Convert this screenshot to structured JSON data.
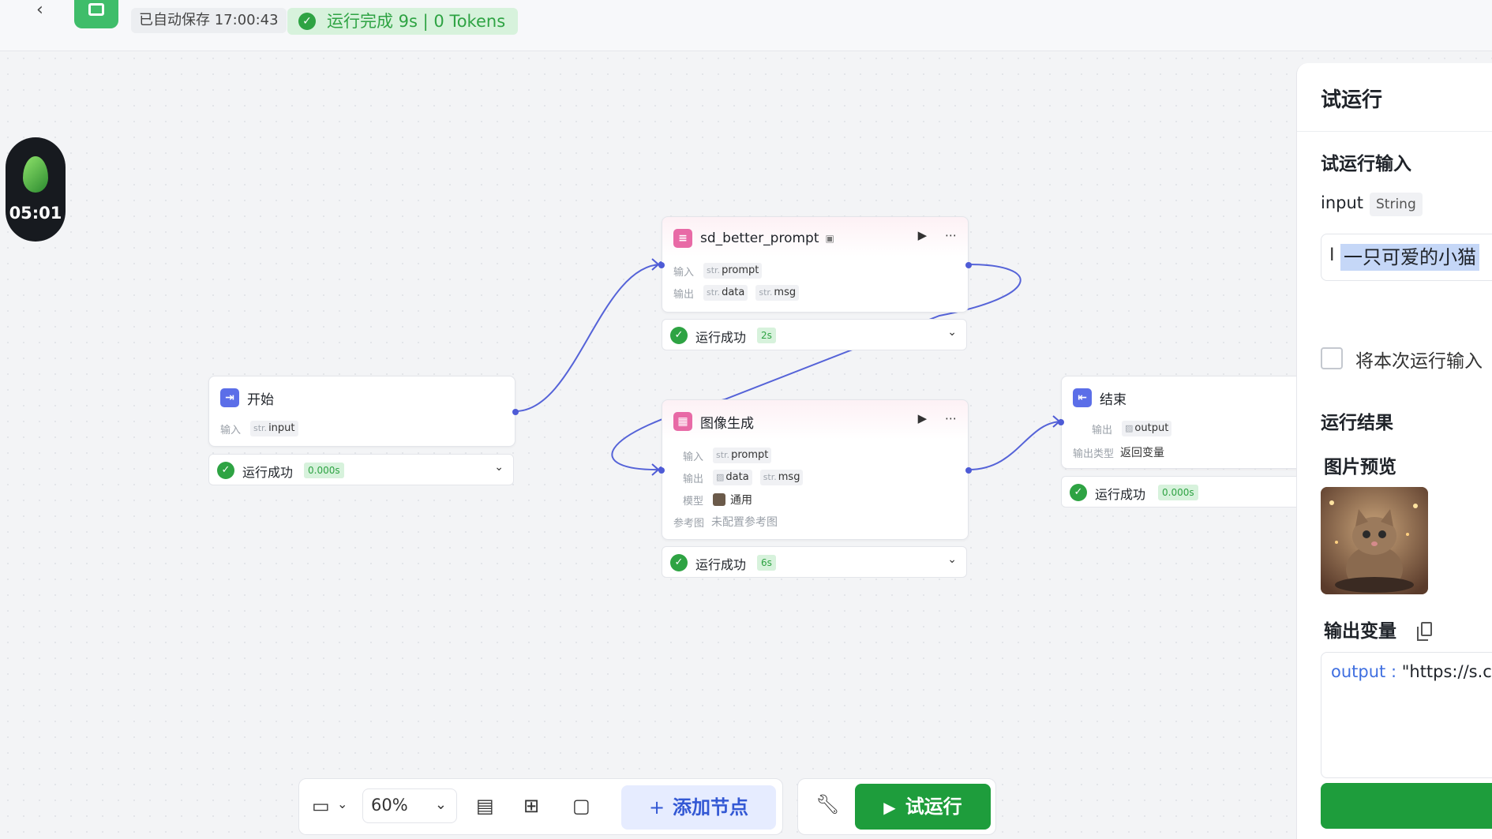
{
  "topbar": {
    "autosave": "已自动保存 17:00:43",
    "run_status": "运行完成 9s | 0 Tokens"
  },
  "timer": {
    "time": "05:01"
  },
  "nodes": {
    "start": {
      "title": "开始",
      "input_label": "输入",
      "input_type": "str.",
      "input_name": "input",
      "status": "运行成功",
      "duration": "0.000s"
    },
    "prompt": {
      "title": "sd_better_prompt",
      "input_label": "输入",
      "output_label": "输出",
      "input_type": "str.",
      "input_name": "prompt",
      "output_type_1": "str.",
      "output_name_1": "data",
      "output_type_2": "str.",
      "output_name_2": "msg",
      "status": "运行成功",
      "duration": "2s"
    },
    "image": {
      "title": "图像生成",
      "input_label": "输入",
      "output_label": "输出",
      "model_label": "模型",
      "ref_label": "参考图",
      "input_type": "str.",
      "input_name": "prompt",
      "output_name_1": "data",
      "output_type_2": "str.",
      "output_name_2": "msg",
      "model_value": "通用",
      "ref_value": "未配置参考图",
      "status": "运行成功",
      "duration": "6s"
    },
    "end": {
      "title": "结束",
      "output_label": "输出",
      "output_name": "output",
      "output_type_label": "输出类型",
      "output_type_value": "返回变量",
      "status": "运行成功",
      "duration": "0.000s"
    }
  },
  "toolbar": {
    "zoom": "60%",
    "add_node": "添加节点",
    "run": "试运行"
  },
  "panel": {
    "title": "试运行",
    "input_section": "试运行输入",
    "input_label": "input",
    "input_type": "String",
    "input_value": "一只可爱的小猫",
    "save_checkbox_label": "将本次运行输入",
    "result_section": "运行结果",
    "image_preview": "图片预览",
    "output_vars": "输出变量",
    "output_key": "output",
    "output_value": "\"https://s.co"
  },
  "colors": {
    "success_green": "#2ea343",
    "edge_blue": "#4e5bd6",
    "run_button": "#1e9d3c"
  }
}
